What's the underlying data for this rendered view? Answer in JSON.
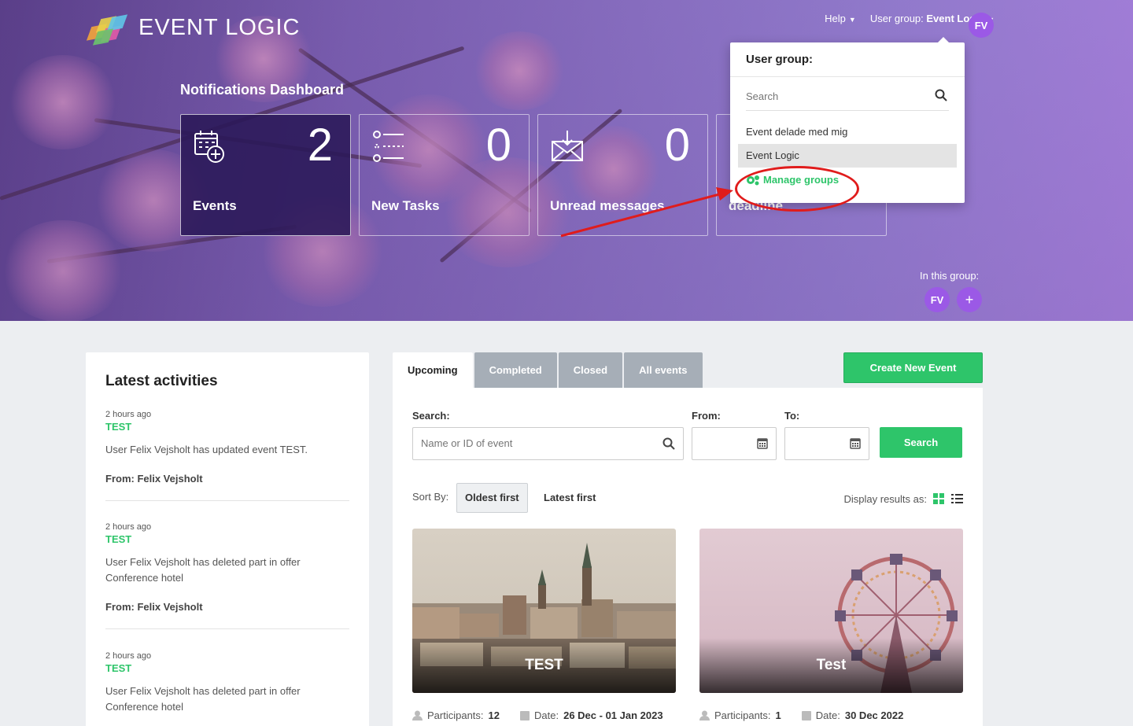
{
  "header": {
    "logo_text": "EVENT LOGIC",
    "help_label": "Help",
    "user_group_label": "User group:",
    "user_group_value": "Event Logic",
    "avatar_initials": "FV"
  },
  "dashboard": {
    "title": "Notifications Dashboard",
    "cards": [
      {
        "label": "Events",
        "count": "2",
        "icon": "calendar-plus-icon"
      },
      {
        "label": "New Tasks",
        "count": "0",
        "icon": "task-list-icon"
      },
      {
        "label": "Unread messages",
        "count": "0",
        "icon": "envelope-icon"
      },
      {
        "label": "deadline",
        "count": "",
        "icon": ""
      }
    ],
    "in_group_label": "In this group:",
    "member_initials": "FV",
    "add_member_label": "+"
  },
  "group_dropdown": {
    "title": "User group:",
    "search_placeholder": "Search",
    "items": [
      "Event delade med mig",
      "Event Logic"
    ],
    "selected": "Event Logic",
    "manage_label": "Manage groups"
  },
  "activities": {
    "title": "Latest activities",
    "items": [
      {
        "time": "2 hours ago",
        "event": "TEST",
        "message": "User Felix Vejsholt has updated event TEST.",
        "from": "From: Felix Vejsholt"
      },
      {
        "time": "2 hours ago",
        "event": "TEST",
        "message": "User Felix Vejsholt has deleted part in offer Conference hotel",
        "from": "From: Felix Vejsholt"
      },
      {
        "time": "2 hours ago",
        "event": "TEST",
        "message": "User Felix Vejsholt has deleted part in offer Conference hotel",
        "from": ""
      }
    ]
  },
  "events": {
    "tabs": [
      "Upcoming",
      "Completed",
      "Closed",
      "All events"
    ],
    "active_tab": "Upcoming",
    "create_label": "Create New Event",
    "search_label": "Search:",
    "search_placeholder": "Name or ID of event",
    "from_label": "From:",
    "to_label": "To:",
    "search_button": "Search",
    "sort_label": "Sort By:",
    "sort_options": [
      "Oldest first",
      "Latest first"
    ],
    "sort_active": "Oldest first",
    "display_label": "Display results as:",
    "cards": [
      {
        "title": "TEST",
        "participants_label": "Participants:",
        "participants": "12",
        "date_label": "Date:",
        "date": "26 Dec - 01 Jan 2023"
      },
      {
        "title": "Test",
        "participants_label": "Participants:",
        "participants": "1",
        "date_label": "Date:",
        "date": "30 Dec 2022"
      }
    ]
  },
  "colors": {
    "accent_green": "#2ec56a",
    "avatar_purple": "#9b59e6",
    "annotation_red": "#e01c1c",
    "card_active": "#2a1858"
  }
}
